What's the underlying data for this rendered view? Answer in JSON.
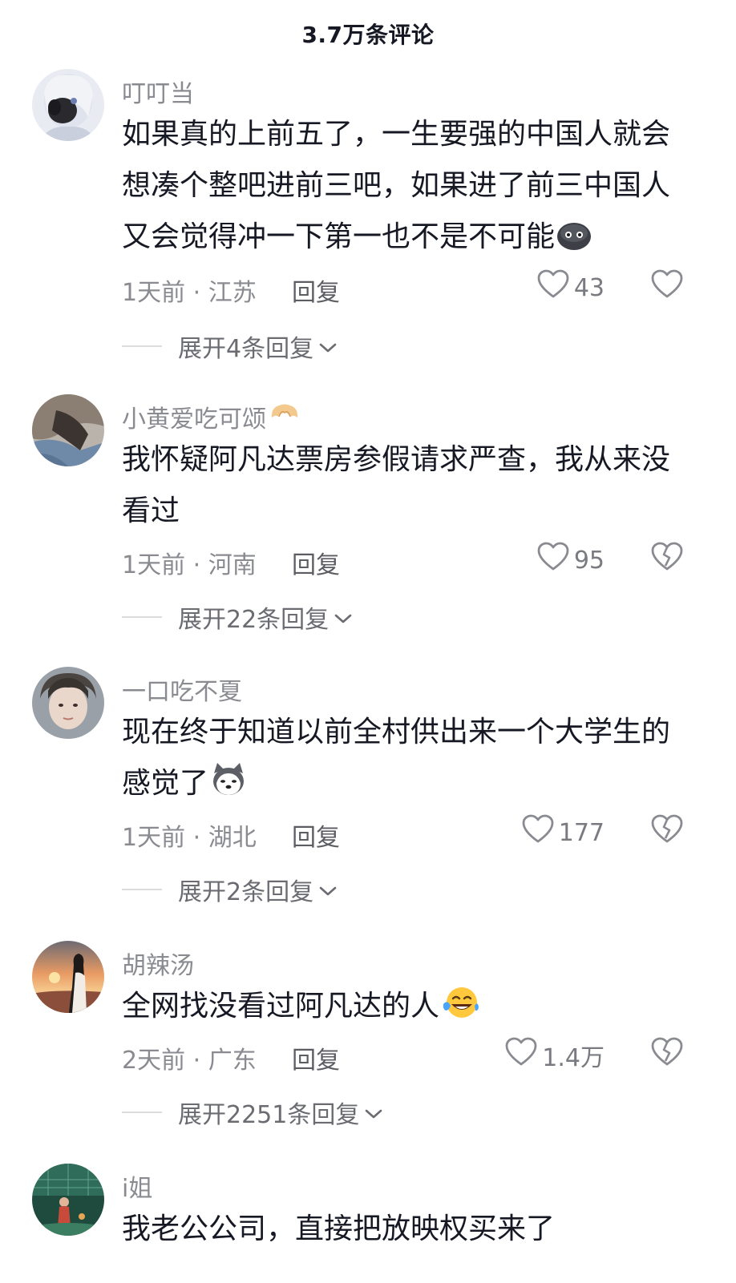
{
  "header": {
    "title": "3.7万条评论"
  },
  "comments": [
    {
      "username": "叮叮当",
      "text": "如果真的上前五了，一生要强的中国人就会想凑个整吧进前三吧，如果进了前三中国人又会觉得冲一下第一也不是不可能",
      "text_emoji": "dark-round-face-emoji",
      "time_location": "1天前 · 江苏",
      "reply_label": "回复",
      "likes": "43",
      "dislike_icon": "heart-outline-icon",
      "expand_label": "展开4条回复"
    },
    {
      "username": "小黄爱吃可颂",
      "username_emoji": "croissant-emoji",
      "text": "我怀疑阿凡达票房参假请求严查，我从来没看过",
      "time_location": "1天前 · 河南",
      "reply_label": "回复",
      "likes": "95",
      "dislike_icon": "broken-heart-icon",
      "expand_label": "展开22条回复"
    },
    {
      "username": "一口吃不夏",
      "text": "现在终于知道以前全村供出来一个大学生的感觉了",
      "text_emoji": "husky-dog-emoji",
      "time_location": "1天前 · 湖北",
      "reply_label": "回复",
      "likes": "177",
      "dislike_icon": "broken-heart-icon",
      "expand_label": "展开2条回复"
    },
    {
      "username": "胡辣汤",
      "text": "全网找没看过阿凡达的人",
      "text_emoji": "laughing-crying-emoji",
      "time_location": "2天前 · 广东",
      "reply_label": "回复",
      "likes": "1.4万",
      "dislike_icon": "broken-heart-icon",
      "expand_label": "展开2251条回复"
    },
    {
      "username": "i姐",
      "text": "我老公公司，直接把放映权买来了"
    }
  ]
}
